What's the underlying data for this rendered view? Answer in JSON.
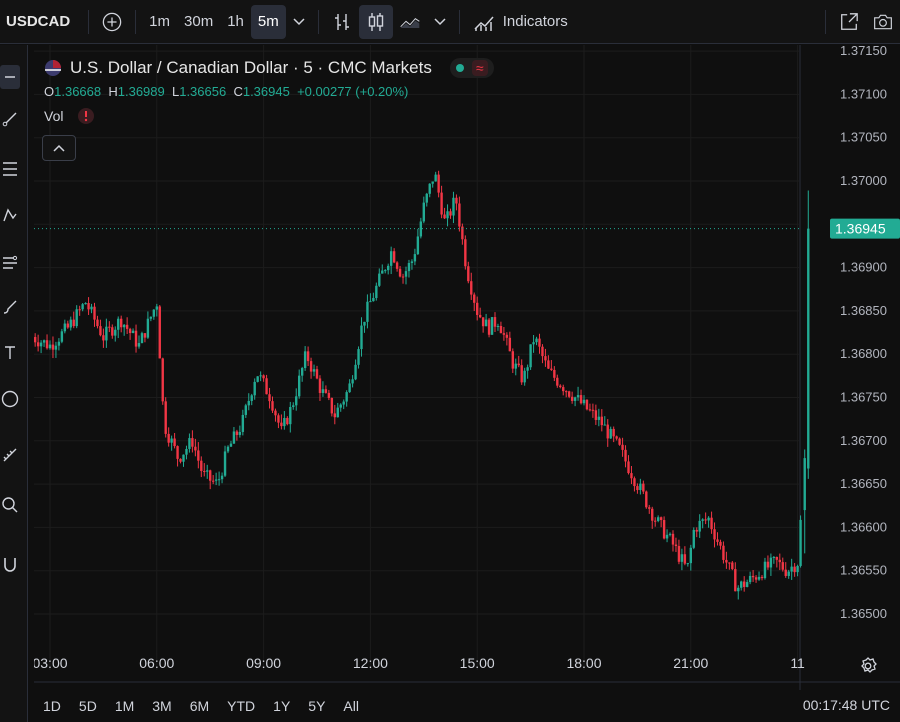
{
  "toolbar": {
    "symbol": "USDCAD",
    "intervals": [
      "1m",
      "30m",
      "1h",
      "5m"
    ],
    "active_interval": "5m",
    "indicators_label": "Indicators"
  },
  "legend": {
    "title": "U.S. Dollar / Canadian Dollar · 5 · CMC Markets",
    "o_label": "O",
    "o_value": "1.36668",
    "h_label": "H",
    "h_value": "1.36989",
    "l_label": "L",
    "l_value": "1.36656",
    "c_label": "C",
    "c_value": "1.36945",
    "change": "+0.00277 (+0.20%)",
    "vol_label": "Vol",
    "wave_symbol": "≈"
  },
  "bottom": {
    "ranges": [
      "1D",
      "5D",
      "1M",
      "3M",
      "6M",
      "YTD",
      "1Y",
      "5Y",
      "All"
    ],
    "clock": "00:17:48 UTC"
  },
  "colors": {
    "up": "#22ab94",
    "down": "#f23645",
    "bg": "#0f0f0f"
  },
  "chart_data": {
    "type": "candlestick",
    "y_ticks": [
      "1.36500",
      "1.36550",
      "1.36600",
      "1.36650",
      "1.36700",
      "1.36750",
      "1.36800",
      "1.36850",
      "1.36900",
      "1.36950",
      "1.37000",
      "1.37050",
      "1.37100",
      "1.37150"
    ],
    "ylim": [
      1.3648,
      1.3716
    ],
    "x_ticks": [
      "03:00",
      "06:00",
      "09:00",
      "12:00",
      "15:00",
      "18:00",
      "21:00",
      "11"
    ],
    "last_price": "1.36945",
    "close_series": [
      [
        2.5,
        1.3682
      ],
      [
        3.0,
        1.3681
      ],
      [
        3.5,
        1.3683
      ],
      [
        4.0,
        1.3686
      ],
      [
        4.5,
        1.3682
      ],
      [
        5.0,
        1.3684
      ],
      [
        5.5,
        1.3681
      ],
      [
        6.0,
        1.3686
      ],
      [
        6.2,
        1.3672
      ],
      [
        6.6,
        1.3668
      ],
      [
        7.0,
        1.367
      ],
      [
        7.3,
        1.3666
      ],
      [
        7.7,
        1.3665
      ],
      [
        8.0,
        1.3669
      ],
      [
        8.4,
        1.3672
      ],
      [
        8.8,
        1.3678
      ],
      [
        9.2,
        1.3675
      ],
      [
        9.5,
        1.3671
      ],
      [
        9.8,
        1.3674
      ],
      [
        10.2,
        1.368
      ],
      [
        10.6,
        1.3676
      ],
      [
        11.0,
        1.3673
      ],
      [
        11.4,
        1.3676
      ],
      [
        11.8,
        1.3684
      ],
      [
        12.2,
        1.3688
      ],
      [
        12.6,
        1.3692
      ],
      [
        12.9,
        1.3689
      ],
      [
        13.2,
        1.3691
      ],
      [
        13.5,
        1.3697
      ],
      [
        13.8,
        1.3701
      ],
      [
        14.1,
        1.3695
      ],
      [
        14.4,
        1.3698
      ],
      [
        14.7,
        1.369
      ],
      [
        15.0,
        1.3685
      ],
      [
        15.3,
        1.3683
      ],
      [
        15.6,
        1.3684
      ],
      [
        16.0,
        1.3679
      ],
      [
        16.3,
        1.3677
      ],
      [
        16.6,
        1.3682
      ],
      [
        17.0,
        1.3678
      ],
      [
        17.5,
        1.3676
      ],
      [
        18.0,
        1.3674
      ],
      [
        18.5,
        1.3672
      ],
      [
        19.0,
        1.3669
      ],
      [
        19.5,
        1.3665
      ],
      [
        20.0,
        1.3661
      ],
      [
        20.5,
        1.3658
      ],
      [
        20.9,
        1.3655
      ],
      [
        21.1,
        1.366
      ],
      [
        21.5,
        1.3661
      ],
      [
        22.0,
        1.3656
      ],
      [
        22.3,
        1.3653
      ],
      [
        22.7,
        1.3654
      ],
      [
        23.0,
        1.3655
      ],
      [
        23.4,
        1.3656
      ],
      [
        23.7,
        1.3655
      ],
      [
        24.0,
        1.3656
      ],
      [
        24.2,
        1.3667
      ],
      [
        24.3,
        1.36945
      ]
    ]
  }
}
